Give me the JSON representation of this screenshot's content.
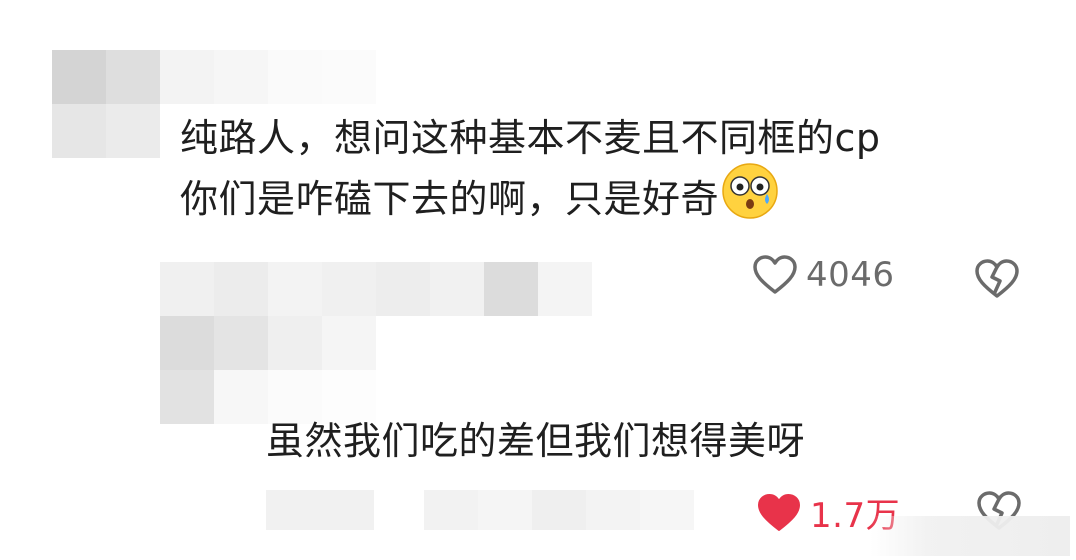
{
  "comments": [
    {
      "text_line1": "纯路人，想问这种基本不麦且不同框的cp",
      "text_line2": "你们是咋磕下去的啊，只是好奇",
      "emoji": "astonished-face-emoji",
      "likes": "4046",
      "liked": false
    },
    {
      "text_line1": "虽然我们吃的差但我们想得美呀",
      "likes": "1.7万",
      "liked": true
    }
  ],
  "colors": {
    "text": "#1f1f1f",
    "muted": "#6b6b6b",
    "like_active": "#e8334a",
    "blur_light": "#eeeeee",
    "blur_mid": "#d9d9d9"
  },
  "icons": {
    "like": "heart-outline-icon",
    "like_active": "heart-filled-icon",
    "dislike": "broken-heart-icon"
  }
}
